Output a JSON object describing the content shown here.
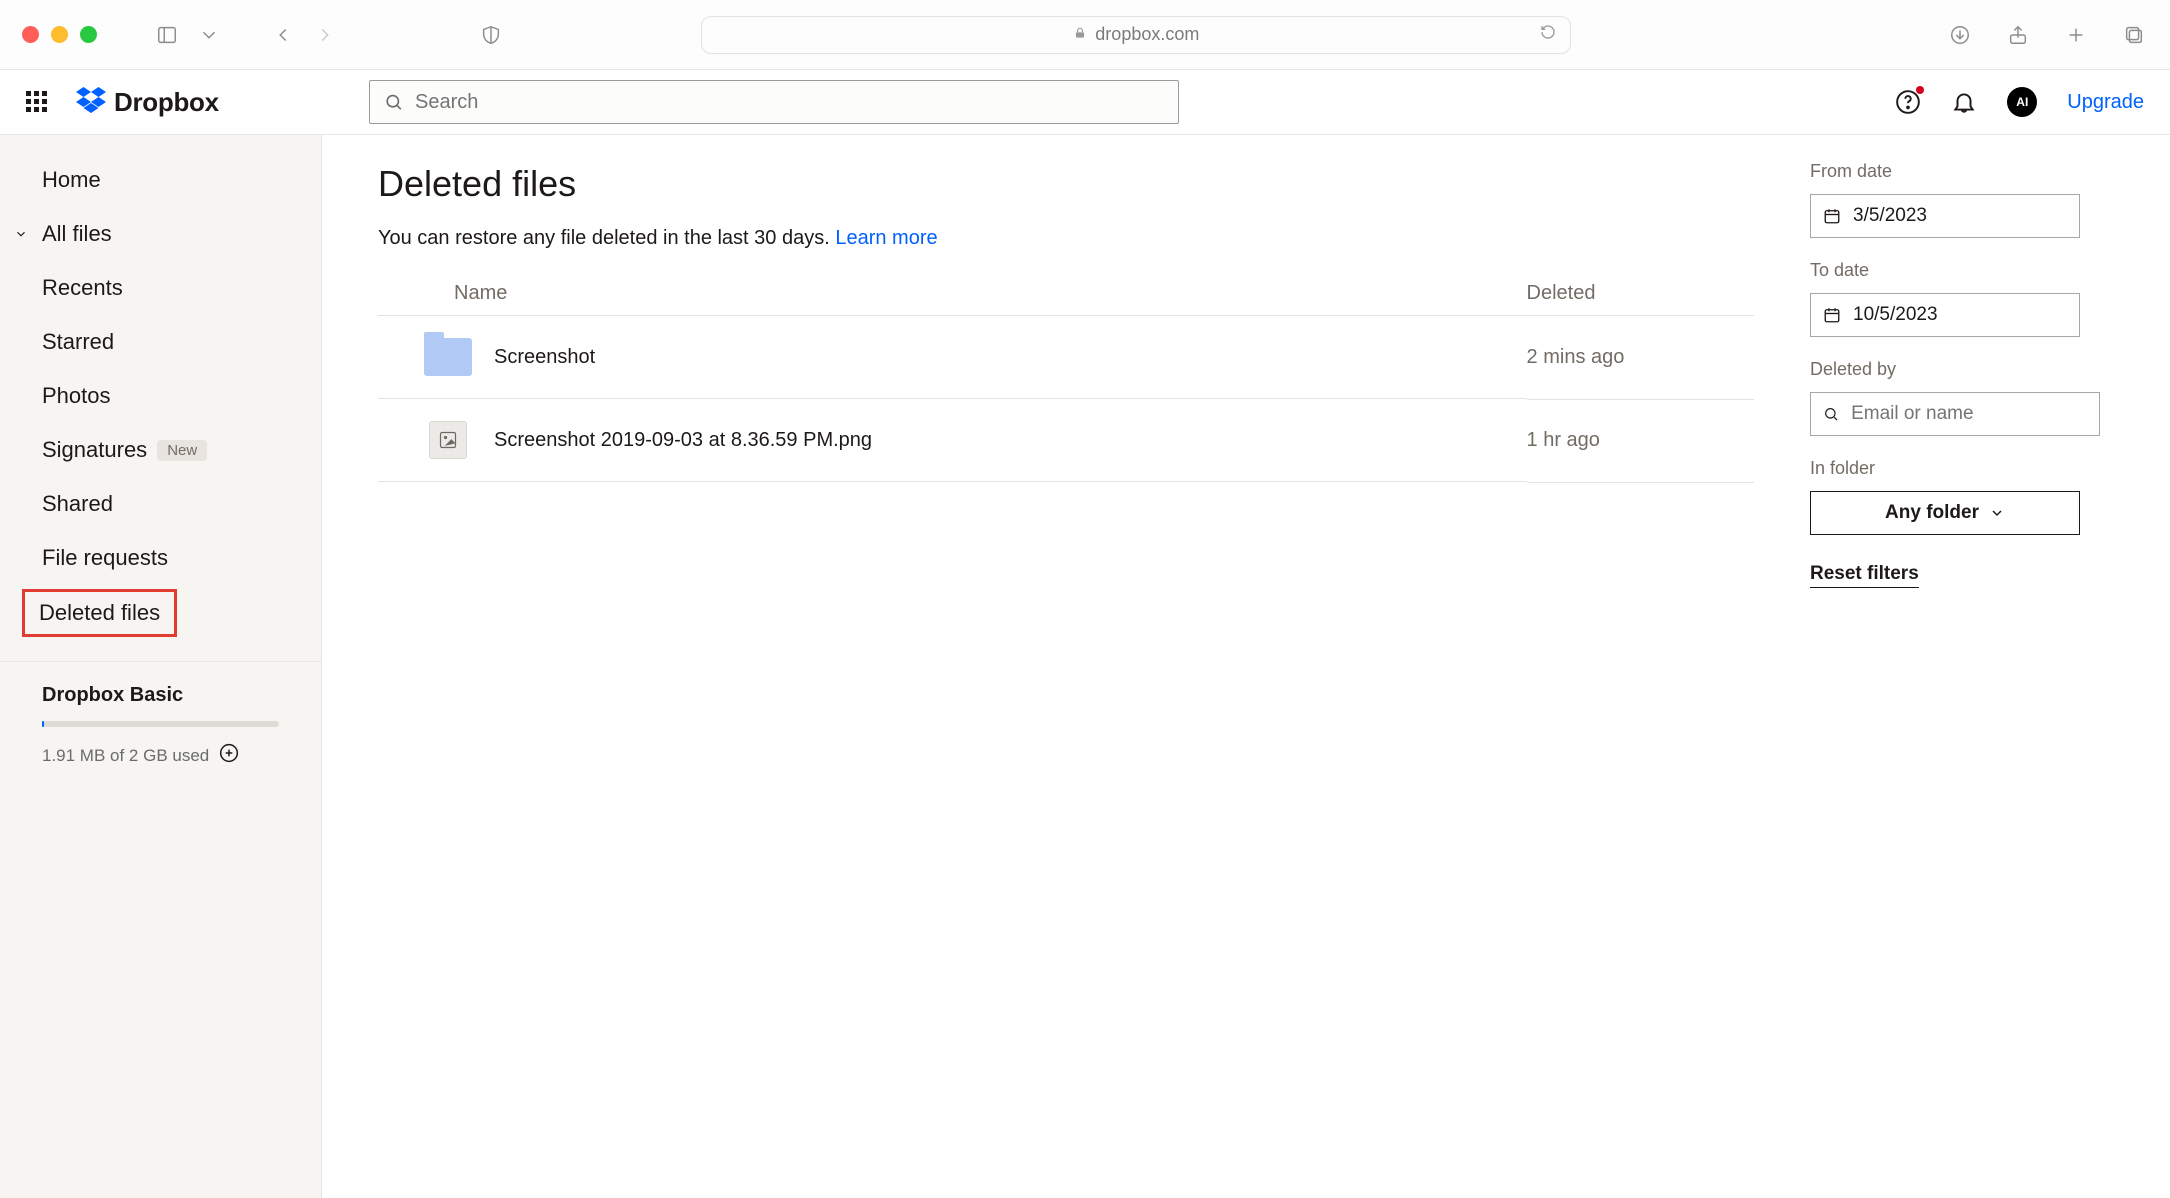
{
  "browser": {
    "url_host": "dropbox.com"
  },
  "header": {
    "brand": "Dropbox",
    "search_placeholder": "Search",
    "avatar_initials": "AI",
    "upgrade_label": "Upgrade"
  },
  "sidebar": {
    "items": {
      "home": "Home",
      "all_files": "All files",
      "recents": "Recents",
      "starred": "Starred",
      "photos": "Photos",
      "signatures": "Signatures",
      "signatures_badge": "New",
      "shared": "Shared",
      "file_requests": "File requests",
      "deleted_files": "Deleted files"
    },
    "plan": {
      "name": "Dropbox Basic",
      "usage_text": "1.91 MB of 2 GB used"
    }
  },
  "page": {
    "title": "Deleted files",
    "subtitle_text": "You can restore any file deleted in the last 30 days. ",
    "learn_more": "Learn more",
    "columns": {
      "name": "Name",
      "deleted": "Deleted"
    },
    "rows": [
      {
        "type": "folder",
        "name": "Screenshot",
        "deleted": "2 mins ago"
      },
      {
        "type": "image",
        "name": "Screenshot 2019-09-03 at 8.36.59 PM.png",
        "deleted": "1 hr ago"
      }
    ]
  },
  "filters": {
    "from_label": "From date",
    "from_value": "3/5/2023",
    "to_label": "To date",
    "to_value": "10/5/2023",
    "deleted_by_label": "Deleted by",
    "deleted_by_placeholder": "Email or name",
    "in_folder_label": "In folder",
    "in_folder_value": "Any folder",
    "reset_label": "Reset filters"
  }
}
